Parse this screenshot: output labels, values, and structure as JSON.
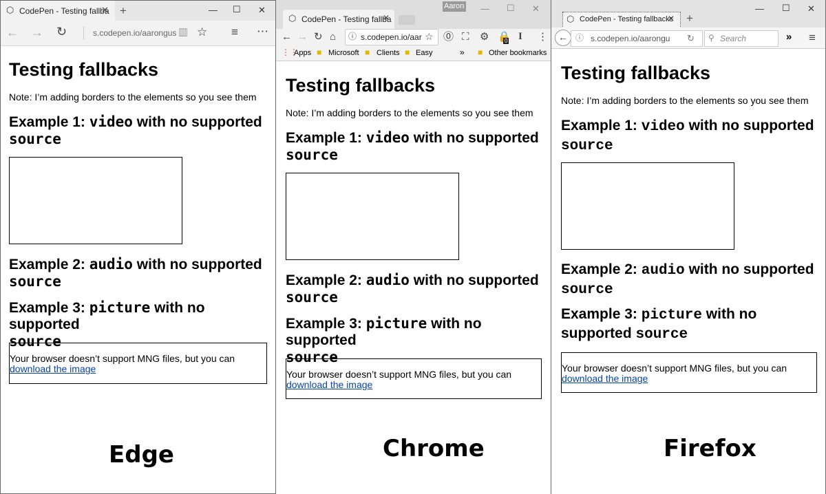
{
  "page": {
    "title": "Testing fallbacks",
    "note": "Note: I’m adding borders to the elements so you see them",
    "example1_prefix": "Example 1: ",
    "example1_code": "video",
    "example1_suffix": " with no supported",
    "example1_line2": "source",
    "example2_prefix": "Example 2: ",
    "example2_code": "audio",
    "example2_suffix": " with no supported",
    "example2_line2": "source",
    "example3_prefix": "Example 3: ",
    "example3_code": "picture",
    "example3_suffix": " with no supported",
    "example3_line2": "source",
    "ff_example3_suffix": " with no",
    "ff_example3_line2_text": "supported ",
    "fallback_text": "Your browser doesn’t support MNG files, but you can",
    "fallback_link": "download the image"
  },
  "edge": {
    "tab_title": "CodePen - Testing fallba",
    "address": "s.codepen.io/aarongus",
    "caption": "Edge"
  },
  "chrome": {
    "tab_title": "CodePen - Testing fallba",
    "profile_name": "Aaron",
    "address": "s.codepen.io/aar",
    "extension_badge": "0",
    "bookmarks": [
      "Apps",
      "Microsoft",
      "Clients",
      "Easy"
    ],
    "overflow": "»",
    "other_bookmarks": "Other bookmarks",
    "caption": "Chrome"
  },
  "firefox": {
    "tab_title": "CodePen - Testing fallbacks",
    "address": "s.codepen.io/aarongu",
    "search_placeholder": "Search",
    "caption": "Firefox"
  }
}
